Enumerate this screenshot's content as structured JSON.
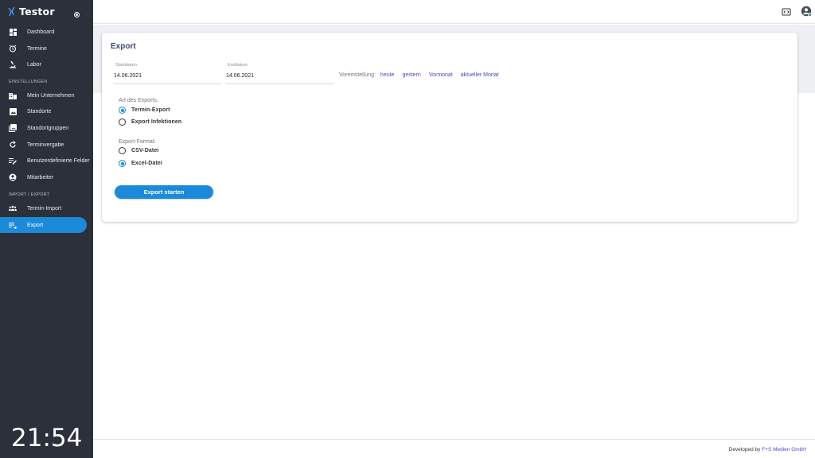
{
  "brand": {
    "name": "Testor"
  },
  "sidebar": {
    "items": [
      {
        "label": "Dashboard",
        "icon": "dashboard-icon"
      },
      {
        "label": "Termine",
        "icon": "alarm-clock-icon"
      },
      {
        "label": "Labor",
        "icon": "microscope-icon"
      }
    ],
    "section_settings": "EINSTELLUNGEN",
    "settings_items": [
      {
        "label": "Mein Unternehmen",
        "icon": "building-icon"
      },
      {
        "label": "Standorte",
        "icon": "image-icon"
      },
      {
        "label": "Standortgruppen",
        "icon": "image-group-icon"
      },
      {
        "label": "Terminvergabe",
        "icon": "refresh-icon"
      },
      {
        "label": "Benutzerdefinierte Felder",
        "icon": "list-edit-icon"
      },
      {
        "label": "Mitarbeiter",
        "icon": "account-circle-icon"
      }
    ],
    "section_import": "IMPORT / EXPORT",
    "import_items": [
      {
        "label": "Termin-Import",
        "icon": "users-icon"
      },
      {
        "label": "Export",
        "icon": "list-export-icon",
        "active": true
      }
    ]
  },
  "clock": "21:54",
  "card": {
    "title": "Export",
    "start": {
      "label": "Startdatum",
      "value": "14.06.2021"
    },
    "end": {
      "label": "Enddatum",
      "value": "14.06.2021"
    },
    "preset": {
      "label": "Voreinstellung:",
      "options": [
        "heute",
        "gestern",
        "Vormonat",
        "aktueller Monat"
      ]
    },
    "type_group": {
      "label": "Art des Exports:",
      "options": [
        "Termin-Export",
        "Export Infektionen"
      ],
      "selected": "Termin-Export"
    },
    "format_group": {
      "label": "Export-Format:",
      "options": [
        "CSV-Datei",
        "Excel-Datei"
      ],
      "selected": "Excel-Datei"
    },
    "submit_label": "Export starten"
  },
  "footer": {
    "prefix": "Developed by",
    "company": "F+S Medien GmbH"
  },
  "colors": {
    "sidebar": "#2b303b",
    "accent": "#1a8ad9",
    "link": "#4a49c8",
    "title": "#3b4a6b"
  }
}
